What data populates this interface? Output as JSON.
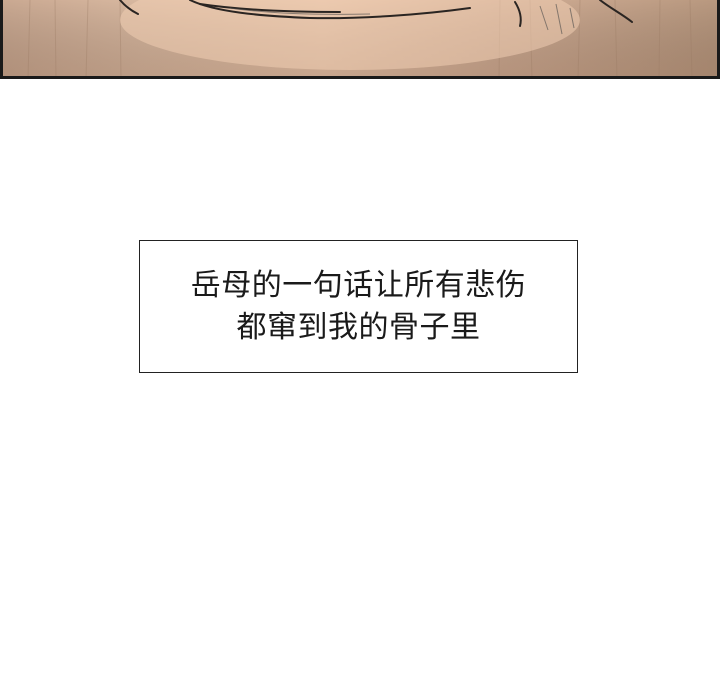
{
  "panel": {
    "top_image": "illustrated comic panel (cropped bottom edge)"
  },
  "caption": {
    "line1": "岳母的一句话让所有悲伤",
    "line2": "都窜到我的骨子里"
  }
}
